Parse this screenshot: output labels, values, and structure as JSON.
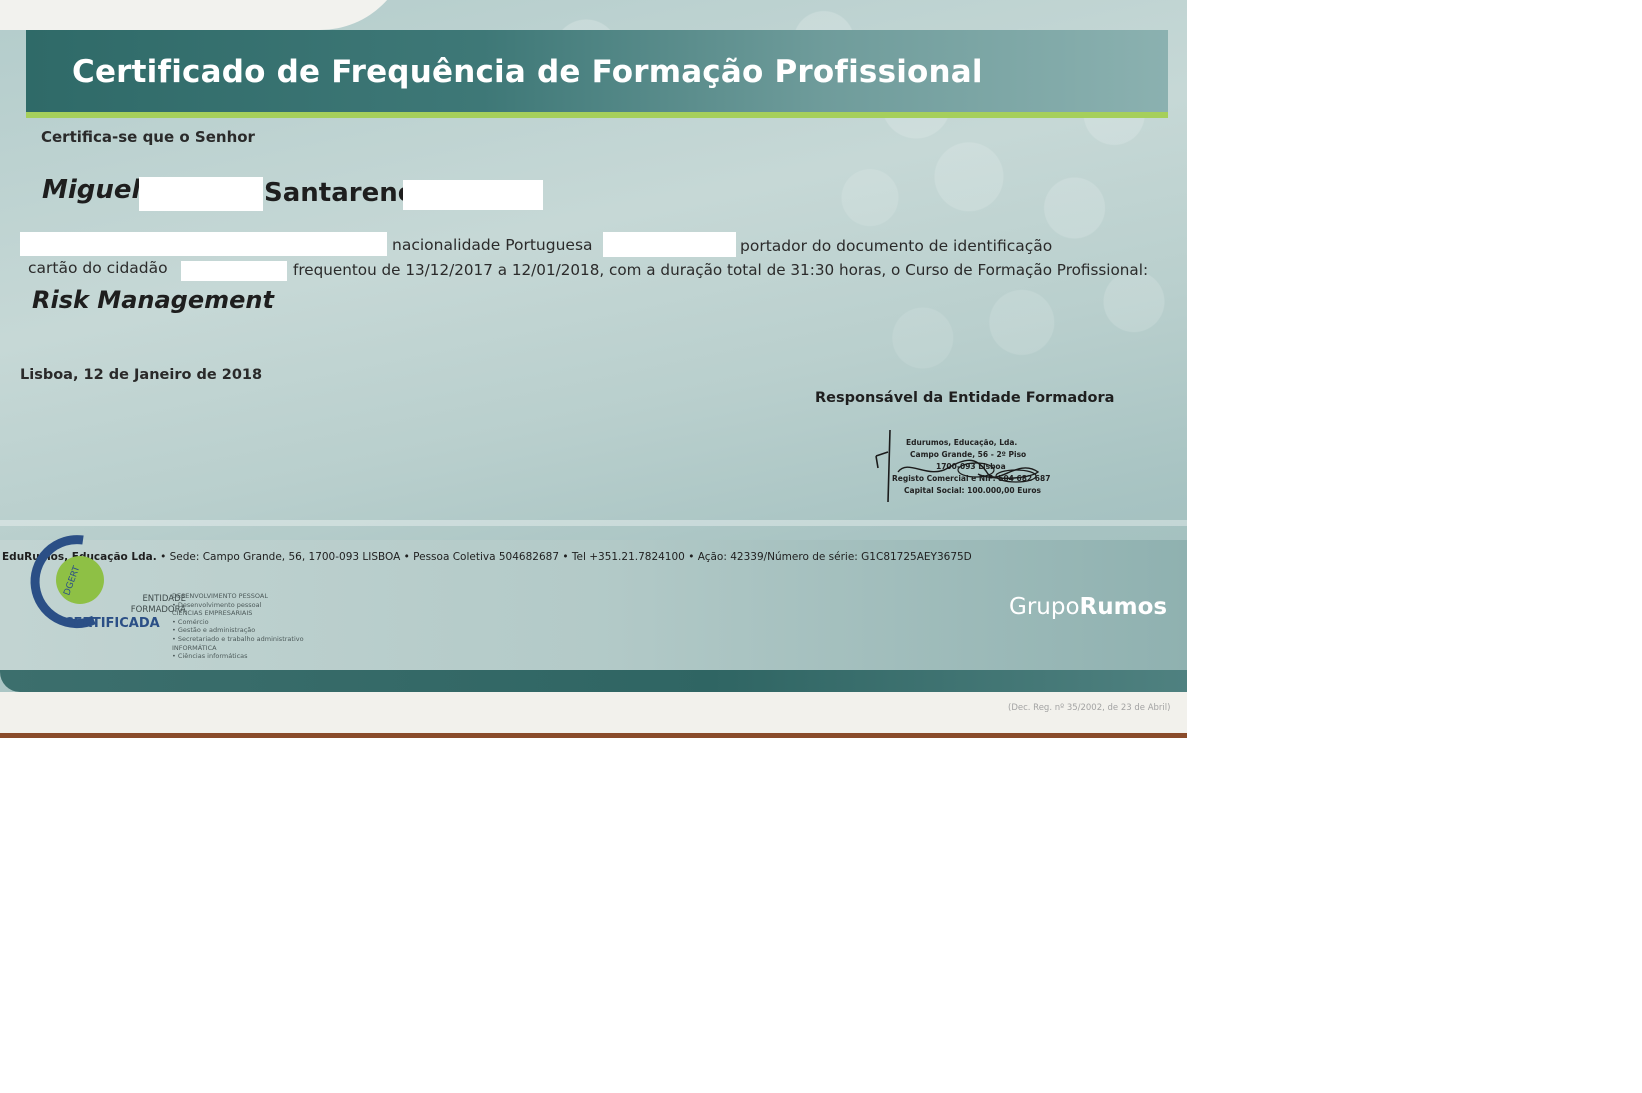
{
  "certificate": {
    "title": "Certificado de Frequência de Formação Profissional",
    "intro": "Certifica-se que o Senhor",
    "first_name": "Miguel",
    "last_name": "Santareno",
    "nationality_text": "nacionalidade Portuguesa",
    "document_text": "portador do documento de identificação",
    "id_card_text": "cartão do cidadão",
    "attendance_text": "frequentou de 13/12/2017 a 12/01/2018, com a duração total de 31:30 horas, o Curso de Formação Profissional:",
    "course": "Risk Management",
    "place_date": "Lisboa, 12 de Janeiro de 2018",
    "signatory_title": "Responsável da Entidade Formadora"
  },
  "stamp": {
    "line1": "Edurumos, Educação, Lda.",
    "line2": "Campo Grande, 56 - 2º Piso",
    "line3": "1700-093 Lisboa",
    "line4": "Registo Comercial e NIF: 504 682 687",
    "line5": "Capital Social: 100.000,00 Euros"
  },
  "footer": {
    "company_bold": "EduRumos, Educação Lda.",
    "company_details": "• Sede: Campo Grande, 56, 1700-093 LISBOA • Pessoa Coletiva 504682687 • Tel +351.21.7824100 •  Ação: 42339/Número de série: G1C81725AEY3675D",
    "brand_light": "Grupo",
    "brand_bold": "Rumos",
    "legal_note": "(Dec. Reg. nº 35/2002, de 23 de Abril)"
  },
  "logo": {
    "dgert": "DGERT",
    "line1": "ENTIDADE",
    "line2": "FORMADORA",
    "line3": "CERTIFICADA",
    "areas": "DESENVOLVIMENTO PESSOAL\n• Desenvolvimento pessoal\nCIÊNCIAS EMPRESARIAIS\n• Comércio\n• Gestão e administração\n• Secretariado e trabalho administrativo\nINFORMÁTICA\n• Ciências informáticas"
  },
  "colors": {
    "title_band": "#3e7877",
    "accent_green": "#a6cf5b",
    "text_dark": "#222222",
    "footer_bar": "#2f6563"
  }
}
